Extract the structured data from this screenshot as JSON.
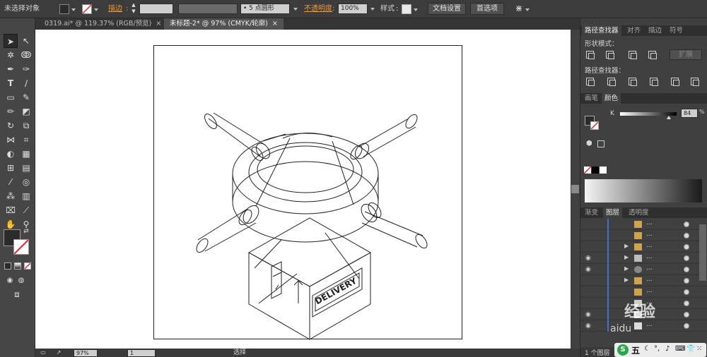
{
  "control_bar": {
    "selection_text": "未选择对象",
    "stroke_label": "描边",
    "stroke_weight": "",
    "brush_value": "5 点圆形",
    "opacity_label": "不透明度",
    "opacity_value": "100%",
    "style_label": "样式",
    "doc_setup_button": "文档设置",
    "preferences_button": "首选项"
  },
  "document_tabs": [
    {
      "label": "0319.ai* @ 119.37% (RGB/预览)",
      "close": "×",
      "active": false
    },
    {
      "label": "未标题-2* @ 97% (CMYK/轮廓)",
      "close": "×",
      "active": true
    }
  ],
  "artboard": {
    "box_text": "DELIVERY"
  },
  "pathfinder": {
    "tabs": [
      "路径查找器",
      "对齐",
      "描边",
      "符号"
    ],
    "shape_modes_label": "形状模式：",
    "expand_button": "扩展",
    "pathfinders_label": "路径查找器："
  },
  "color": {
    "tabs": [
      "画笔",
      "颜色"
    ],
    "channel_label": "K",
    "channel_value": "84"
  },
  "layers": {
    "tabs": [
      "渐变",
      "图层",
      "透明度"
    ],
    "rows": [
      {
        "visible": false,
        "expand": false,
        "name": "..."
      },
      {
        "visible": false,
        "expand": false,
        "name": "..."
      },
      {
        "visible": false,
        "expand": true,
        "name": "..."
      },
      {
        "visible": true,
        "expand": true,
        "name": "..."
      },
      {
        "visible": true,
        "expand": true,
        "name": "..."
      },
      {
        "visible": false,
        "expand": true,
        "name": "..."
      },
      {
        "visible": false,
        "expand": false,
        "name": "..."
      },
      {
        "visible": false,
        "expand": false,
        "name": "..."
      },
      {
        "visible": true,
        "expand": false,
        "name": "..."
      },
      {
        "visible": true,
        "expand": false,
        "name": "..."
      }
    ],
    "footer_text": "1 个图层"
  },
  "status_bar": {
    "zoom_value": "97%",
    "page_value": "1",
    "mode_text": "选择"
  },
  "watermark": {
    "text": "经验",
    "sub": "aidu"
  },
  "taskbar": {
    "ime_text": "五"
  },
  "colors": {
    "fill": "#2b2b2b",
    "accent_label": "#e89a3c",
    "canvas": "#ffffff",
    "layer_blue": "#3f6fd0"
  }
}
